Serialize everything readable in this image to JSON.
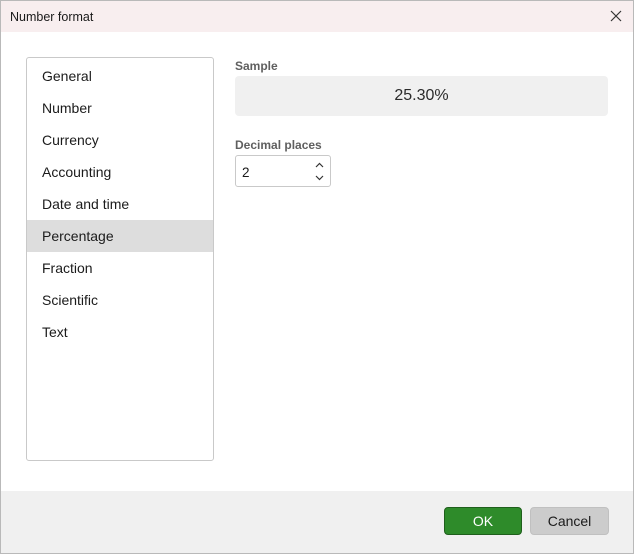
{
  "window": {
    "title": "Number format"
  },
  "categories": {
    "items": [
      {
        "label": "General"
      },
      {
        "label": "Number"
      },
      {
        "label": "Currency"
      },
      {
        "label": "Accounting"
      },
      {
        "label": "Date and time"
      },
      {
        "label": "Percentage"
      },
      {
        "label": "Fraction"
      },
      {
        "label": "Scientific"
      },
      {
        "label": "Text"
      }
    ],
    "selected": "Percentage"
  },
  "sample": {
    "label": "Sample",
    "value": "25.30%"
  },
  "decimal_places": {
    "label": "Decimal places",
    "value": "2"
  },
  "footer": {
    "ok_label": "OK",
    "cancel_label": "Cancel"
  },
  "colors": {
    "ok_accent": "#2e8b2a",
    "selected_item_bg": "#dddddd",
    "titlebar_bg": "#f8eeef"
  },
  "icons": {
    "close": "close-icon",
    "spin_up": "chevron-up-icon",
    "spin_down": "chevron-down-icon"
  }
}
